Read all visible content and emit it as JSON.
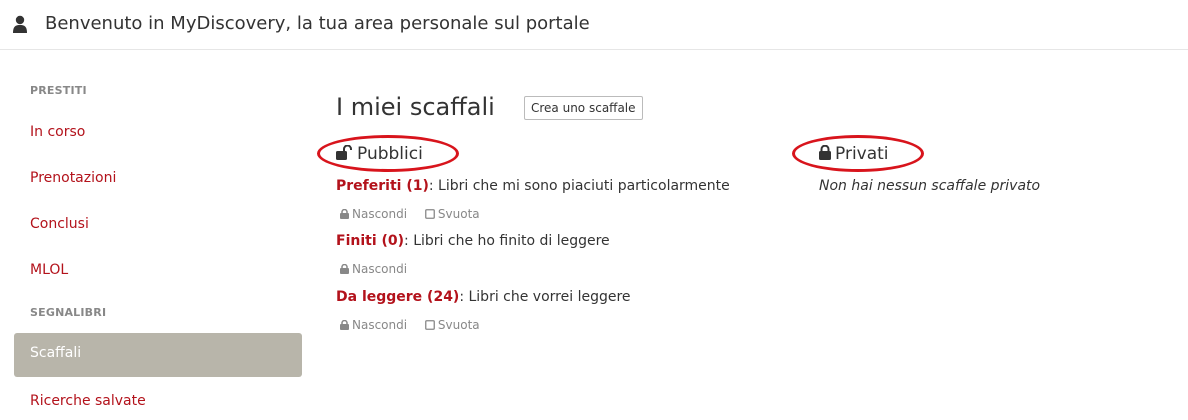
{
  "header": {
    "title": "Benvenuto in MyDiscovery, la tua area personale sul portale",
    "icon": "user-icon"
  },
  "sidebar": {
    "section_loans": "PRESTITI",
    "loan_items": [
      "In corso",
      "Prenotazioni",
      "Conclusi",
      "MLOL"
    ],
    "section_bookmarks": "SEGNALIBRI",
    "active_item": "Scaffali",
    "saved_searches": "Ricerche salvate"
  },
  "main": {
    "title": "I miei scaffali",
    "create_button": "Crea uno scaffale",
    "public": {
      "heading": "Pubblici",
      "icon": "unlock-icon",
      "shelves": [
        {
          "name": "Preferiti (1)",
          "description": ": Libri che mi sono piaciuti particolarmente",
          "hide": "Nascondi",
          "empty": "Svuota"
        },
        {
          "name": "Finiti (0)",
          "description": ": Libri che ho finito di leggere",
          "hide": "Nascondi"
        },
        {
          "name": "Da leggere (24)",
          "description": ": Libri che vorrei leggere",
          "hide": "Nascondi",
          "empty": "Svuota"
        }
      ]
    },
    "private": {
      "heading": "Privati",
      "icon": "lock-icon",
      "empty_message": "Non hai nessun scaffale privato"
    }
  },
  "colors": {
    "accent": "#b3121b",
    "active_bg": "#b8b5aa",
    "highlight": "#d8141c",
    "muted": "#888888"
  }
}
